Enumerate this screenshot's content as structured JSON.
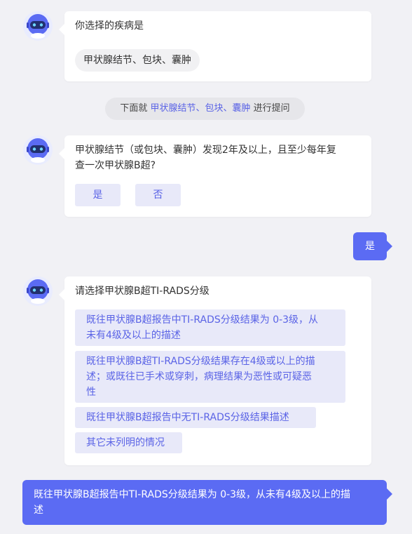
{
  "block1": {
    "question": "你选择的疾病是",
    "chip": "甲状腺结节、包块、囊肿"
  },
  "notice": {
    "prefix": "下面就",
    "topic": "甲状腺结节、包块、囊肿",
    "suffix": "进行提问"
  },
  "block2": {
    "question_line1": "甲状腺结节（或包块、囊肿）发现2年及以上，且至少每年复",
    "question_line2": "查一次甲状腺B超?",
    "yes": "是",
    "no": "否"
  },
  "reply1": "是",
  "block3": {
    "question": "请选择甲状腺B超TI-RADS分级",
    "option1_line1": "既往甲状腺B超报告中TI-RADS分级结果为 0-3级，从",
    "option1_line2": "未有4级及以上的描述",
    "option2_line1": "既往甲状腺B超TI-RADS分级结果存在4级或以上的描",
    "option2_line2": "述；或既往已手术或穿刺，病理结果为恶性或可疑恶",
    "option2_line3": "性",
    "option3": "既往甲状腺B超报告中无TI-RADS分级结果描述",
    "option4": "其它未列明的情况"
  },
  "reply2_line1": "既往甲状腺B超报告中TI-RADS分级结果为 0-3级，从未有4级及以上的描",
  "reply2_line2": "述",
  "colors": {
    "accent": "#5b6bf3",
    "option_bg": "#e8e9f9",
    "option_text": "#5a63e6",
    "page_bg": "#f1f1f5"
  },
  "icons": {
    "avatar": "robot-avatar-icon"
  }
}
